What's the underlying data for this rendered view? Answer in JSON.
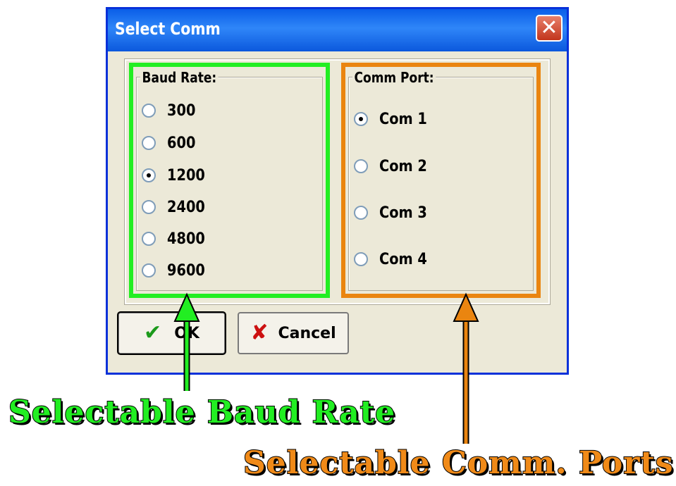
{
  "dialog": {
    "title": "Select Comm",
    "close_label": "✕"
  },
  "baud_group": {
    "legend": "Baud Rate:",
    "options": [
      "300",
      "600",
      "1200",
      "2400",
      "4800",
      "9600"
    ],
    "selected": "1200"
  },
  "port_group": {
    "legend": "Comm Port:",
    "options": [
      "Com 1",
      "Com 2",
      "Com 3",
      "Com 4"
    ],
    "selected": "Com 1"
  },
  "buttons": {
    "ok_label": "OK",
    "ok_icon": "checkmark-icon",
    "cancel_label": "Cancel",
    "cancel_icon": "x-icon"
  },
  "annotations": {
    "baud_caption": "Selectable Baud Rate",
    "port_caption": "Selectable Comm. Ports",
    "baud_color": "#22ee22",
    "port_color": "#ea8510"
  }
}
